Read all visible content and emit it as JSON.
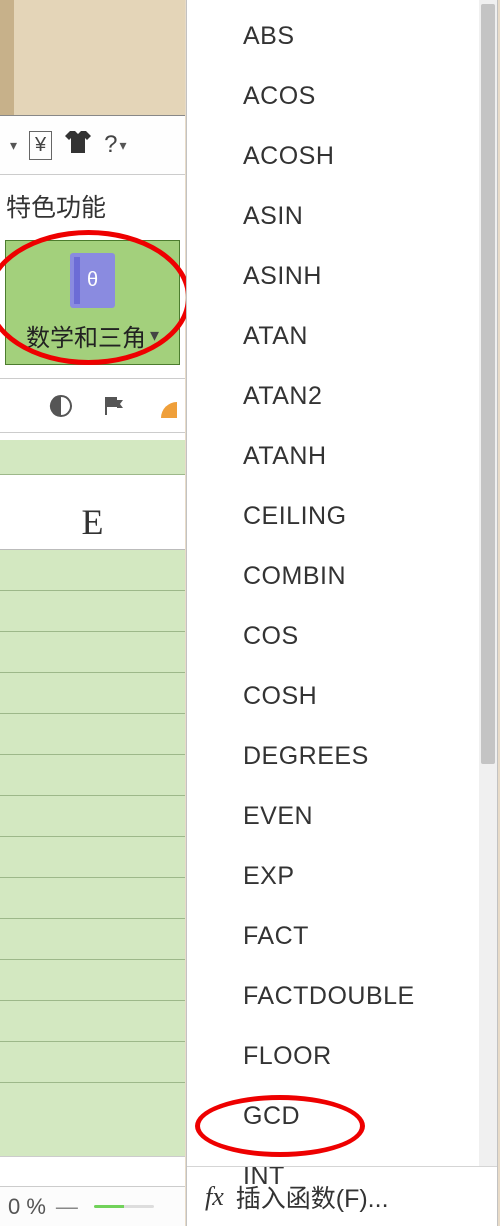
{
  "panel": {
    "features_label": "特色功能"
  },
  "math_button": {
    "label": "数学和三角"
  },
  "column_header": "E",
  "status": {
    "zoom": "0 %",
    "dash": "—"
  },
  "menu": {
    "items": [
      "ABS",
      "ACOS",
      "ACOSH",
      "ASIN",
      "ASINH",
      "ATAN",
      "ATAN2",
      "ATANH",
      "CEILING",
      "COMBIN",
      "COS",
      "COSH",
      "DEGREES",
      "EVEN",
      "EXP",
      "FACT",
      "FACTDOUBLE",
      "FLOOR",
      "GCD",
      "INT"
    ],
    "footer_label": "插入函数(F)...",
    "fx": "fx"
  },
  "icons": {
    "currency": "¥",
    "tshirt": "👕",
    "help": "?",
    "math_glyph": "θ",
    "dropdown": "▾",
    "doc": "◧",
    "flag": "⚑"
  }
}
